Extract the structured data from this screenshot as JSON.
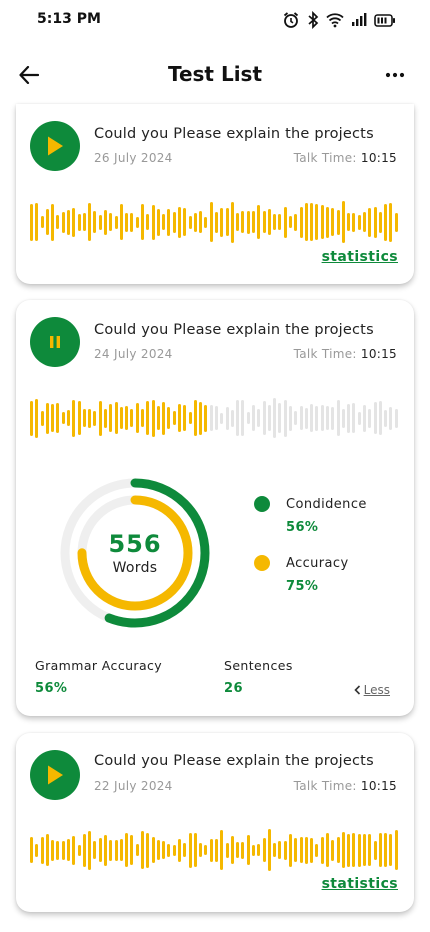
{
  "status_bar": {
    "time": "5:13 PM",
    "icons": [
      "alarm-icon",
      "bluetooth-icon",
      "wifi-icon",
      "signal-icon",
      "battery-icon"
    ]
  },
  "header": {
    "title": "Test List",
    "back_icon": "back-arrow-icon",
    "menu_icon": "more-options-icon"
  },
  "colors": {
    "primary_green": "#0e8a3b",
    "accent_yellow": "#f5b800",
    "wave_inactive": "#e4e4e4"
  },
  "cards": [
    {
      "title": "Could you Please explain the projects",
      "date": "26 July 2024",
      "talk_time_label": "Talk Time:",
      "talk_time": "10:15",
      "state": "paused",
      "link": "statistics"
    },
    {
      "title": "Could you Please explain the projects",
      "date": "24 July 2024",
      "talk_time_label": "Talk Time:",
      "talk_time": "10:15",
      "state": "playing",
      "progress": 0.48,
      "words_count": "556",
      "words_label": "Words",
      "confidence_label": "Condidence",
      "confidence_value": "56%",
      "confidence_fraction": 0.56,
      "accuracy_label": "Accuracy",
      "accuracy_value": "75%",
      "accuracy_fraction": 0.75,
      "grammar_label": "Grammar Accuracy",
      "grammar_value": "56%",
      "sentences_label": "Sentences",
      "sentences_value": "26",
      "less_label": "Less"
    },
    {
      "title": "Could you Please explain the projects",
      "date": "22 July 2024",
      "talk_time_label": "Talk Time:",
      "talk_time": "10:15",
      "state": "paused",
      "link": "statistics"
    }
  ]
}
